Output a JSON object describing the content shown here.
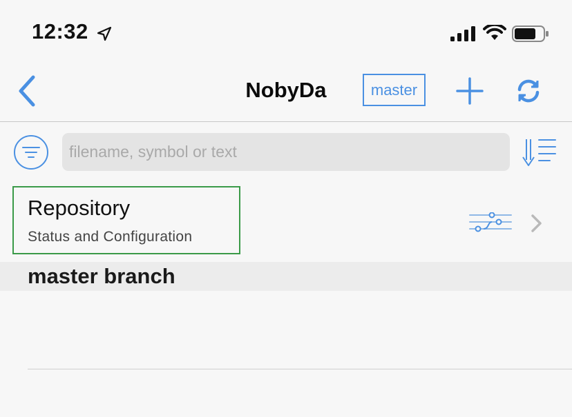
{
  "status_bar": {
    "time": "12:32"
  },
  "nav": {
    "back_icon": "chevron-left-icon",
    "title": "NobyDa",
    "branch_label": "master",
    "add_icon": "plus-icon",
    "refresh_icon": "refresh-icon"
  },
  "search": {
    "placeholder": "filename, symbol or text",
    "value": "",
    "filter_icon": "filter-icon",
    "sort_icon": "sort-icon"
  },
  "repository": {
    "title": "Repository",
    "subtitle": "Status and Configuration",
    "icon": "git-branch-icon"
  },
  "section": {
    "title": "master branch"
  },
  "colors": {
    "accent": "#4a90e2",
    "highlight": "#3a9a48"
  }
}
